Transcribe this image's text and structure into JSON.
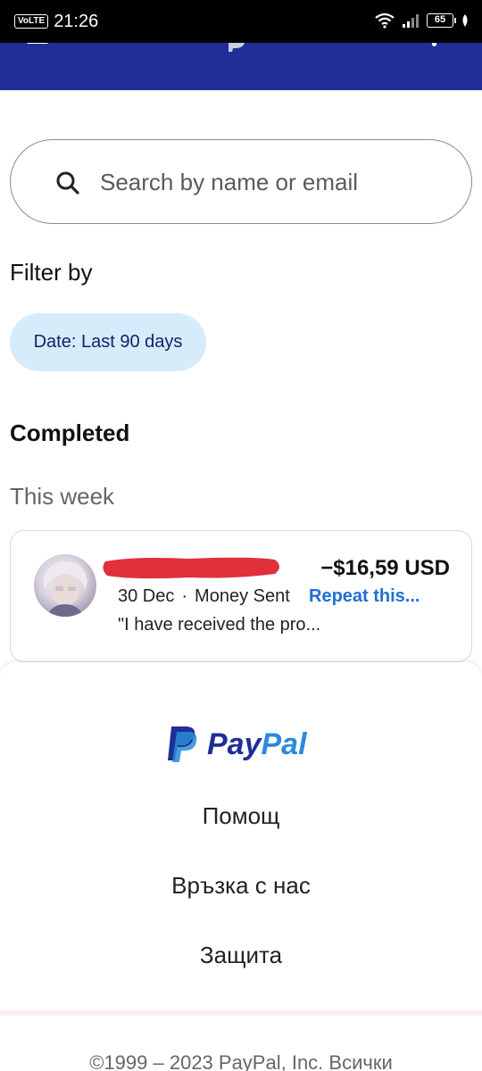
{
  "status_bar": {
    "volte": "VoLTE",
    "time": "21:26",
    "battery": "65",
    "wifi_icon": "wifi-icon",
    "signal_icon": "signal-icon"
  },
  "header": {
    "background": "#1f2f96",
    "menu_icon": "menu-icon",
    "logo_icon": "paypal-logo-icon",
    "more_icon": "more-icon"
  },
  "search": {
    "placeholder": "Search by name or email",
    "value": "",
    "icon": "search-icon"
  },
  "filter": {
    "label": "Filter by",
    "chip_label": "Date: Last 90 days"
  },
  "activity": {
    "section_title": "Completed",
    "group_label": "This week",
    "transactions": [
      {
        "name": "",
        "amount": "−$16,59 USD",
        "date": "30 Dec",
        "separator": "·",
        "type": "Money Sent",
        "action": "Repeat this...",
        "note": "\"I have received the pro..."
      }
    ]
  },
  "footer": {
    "brand_pay": "Pay",
    "brand_pal": "Pal",
    "links": [
      "Помощ",
      "Връзка с нас",
      "Защита"
    ],
    "copyright": "©1999 – 2023 PayPal, Inc. Всички"
  },
  "colors": {
    "brand_dark": "#1f2f96",
    "brand_light": "#2a8bdb",
    "chip_bg": "#d6ecfb",
    "link": "#1f6fd6",
    "redaction": "#e0303a"
  }
}
